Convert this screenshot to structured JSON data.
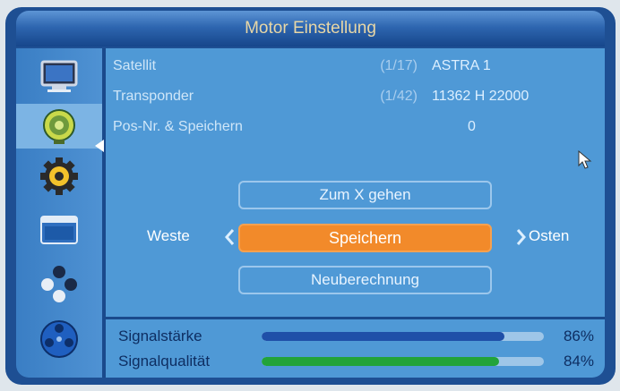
{
  "window": {
    "title": "Motor Einstellung"
  },
  "sidebar": {
    "items": [
      {
        "icon": "monitor-icon",
        "active": false
      },
      {
        "icon": "satellite-dish-icon",
        "active": true
      },
      {
        "icon": "gear-icon",
        "active": false
      },
      {
        "icon": "media-player-icon",
        "active": false
      },
      {
        "icon": "games-icon",
        "active": false
      },
      {
        "icon": "film-reel-icon",
        "active": false
      }
    ]
  },
  "settings": {
    "satellit": {
      "label": "Satellit",
      "index": "(1/17)",
      "value": "ASTRA 1"
    },
    "transponder": {
      "label": "Transponder",
      "index": "(1/42)",
      "value": "11362 H 22000"
    },
    "position": {
      "label": "Pos-Nr. & Speichern",
      "value": "0"
    }
  },
  "actions": {
    "goto_x": "Zum X gehen",
    "save": "Speichern",
    "recalc": "Neuberechnung",
    "west": "Weste",
    "east": "Osten"
  },
  "signal": {
    "strength": {
      "label": "Signalstärke",
      "percent": 86,
      "percent_text": "86%",
      "color": "#1f4fa8"
    },
    "quality": {
      "label": "Signalqualität",
      "percent": 84,
      "percent_text": "84%",
      "color": "#22a33a"
    }
  }
}
